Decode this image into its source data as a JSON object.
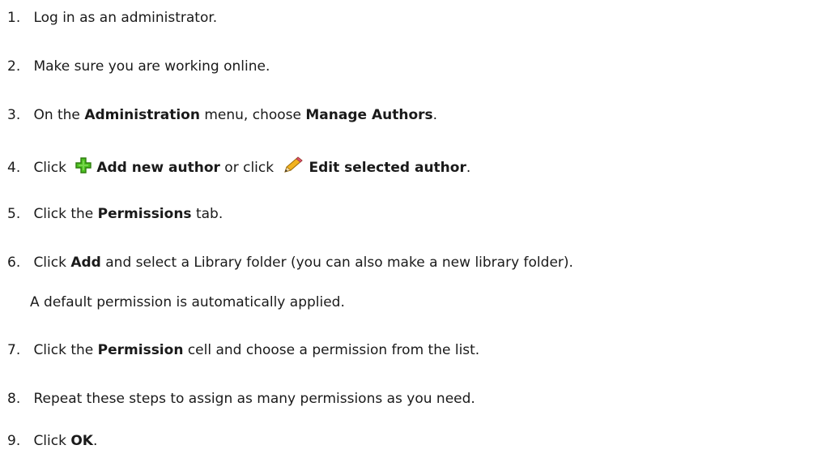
{
  "steps": [
    {
      "num": "1.",
      "text": "Log in as an administrator."
    },
    {
      "num": "2.",
      "text": "Make sure you are working online."
    },
    {
      "num": "3.",
      "pre": "On the ",
      "b1": "Administration",
      "mid": " menu, choose ",
      "b2": "Manage Authors",
      "post": "."
    },
    {
      "num": "4.",
      "pre": "Click ",
      "icon1": "green-plus-icon",
      "b1": "Add new author",
      "mid": " or click ",
      "icon2": "pencil-icon",
      "b2": "Edit selected author",
      "post": "."
    },
    {
      "num": "5.",
      "pre": "Click the ",
      "b1": "Permissions",
      "post": " tab."
    },
    {
      "num": "6.",
      "pre": "Click ",
      "b1": "Add",
      "post": " and select a Library folder (you can also make a new library folder).",
      "note": "A default permission is automatically applied."
    },
    {
      "num": "7.",
      "pre": "Click the ",
      "b1": "Permission",
      "post": " cell and choose a permission from the list."
    },
    {
      "num": "8.",
      "text": "Repeat these steps to assign as many permissions as you need."
    },
    {
      "num": "9.",
      "pre": "Click ",
      "b1": "OK",
      "post": "."
    }
  ]
}
